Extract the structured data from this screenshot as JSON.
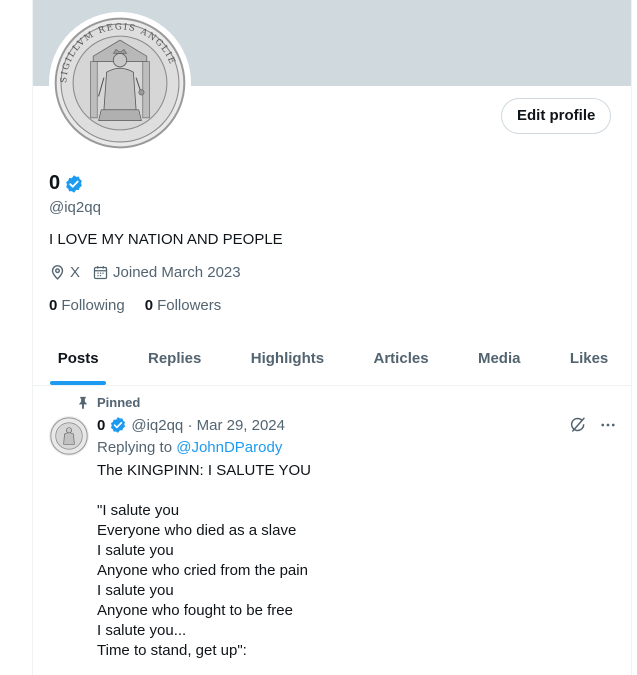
{
  "profile": {
    "name": "0",
    "handle": "@iq2qq",
    "bio": "I LOVE MY NATION AND PEOPLE",
    "location": "X",
    "joined": "Joined March 2023",
    "following_count": "0",
    "following_label": "Following",
    "followers_count": "0",
    "followers_label": "Followers",
    "edit_label": "Edit profile",
    "seal_text": "SIGILLVM REGIS ANGLIE"
  },
  "tabs": [
    {
      "label": "Posts",
      "active": true
    },
    {
      "label": "Replies"
    },
    {
      "label": "Highlights"
    },
    {
      "label": "Articles"
    },
    {
      "label": "Media"
    },
    {
      "label": "Likes"
    }
  ],
  "post": {
    "pinned_label": "Pinned",
    "name": "0",
    "meta": "@iq2qq · Mar 29, 2024",
    "replying_prefix": "Replying to",
    "replying_to": "@JohnDParody",
    "text": "The KINGPINN: I SALUTE YOU\n\n\"I salute you\nEveryone who died as a slave\nI salute you\nAnyone who cried from the pain\nI salute you\nAnyone who fought to be free\nI salute you...\nTime to stand, get up\":"
  },
  "colors": {
    "accent": "#1d9bf0",
    "banner": "#cfd9de",
    "secondary_text": "#536471"
  },
  "icons": [
    "location-icon",
    "calendar-icon",
    "verified-icon",
    "pin-icon",
    "grok-icon",
    "more-icon"
  ]
}
